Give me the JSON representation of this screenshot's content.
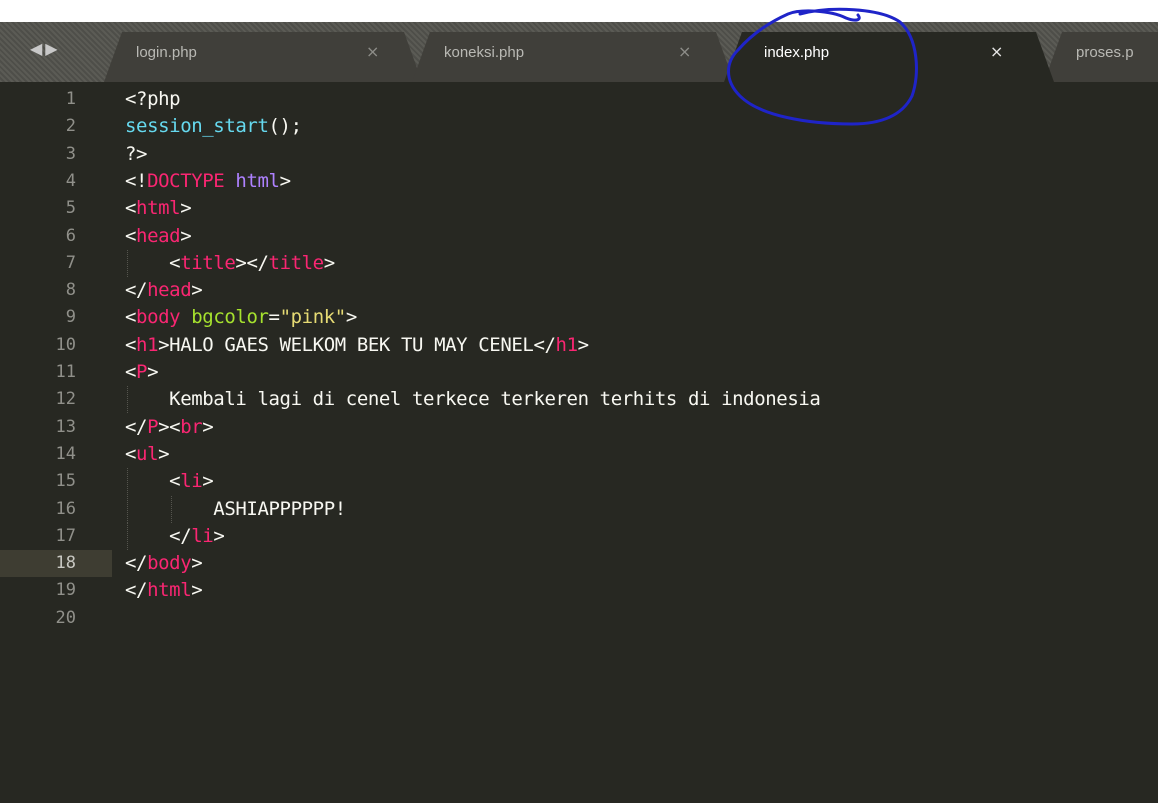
{
  "nav": {
    "arrows": "◀▶"
  },
  "tabs": [
    {
      "label": "login.php",
      "close": "×",
      "active": false
    },
    {
      "label": "koneksi.php",
      "close": "×",
      "active": false
    },
    {
      "label": "index.php",
      "close": "×",
      "active": true
    },
    {
      "label": "proses.p",
      "close": "",
      "active": false
    }
  ],
  "editor": {
    "current_line": 18,
    "lines": [
      {
        "n": "1",
        "tokens": [
          [
            "punc",
            "<?php"
          ]
        ]
      },
      {
        "n": "2",
        "tokens": [
          [
            "fn",
            "session_start"
          ],
          [
            "punc",
            "();"
          ]
        ]
      },
      {
        "n": "3",
        "tokens": [
          [
            "punc",
            "?>"
          ]
        ]
      },
      {
        "n": "4",
        "tokens": [
          [
            "punc",
            "<!"
          ],
          [
            "tag",
            "DOCTYPE"
          ],
          [
            "punc",
            " "
          ],
          [
            "kw",
            "html"
          ],
          [
            "punc",
            ">"
          ]
        ]
      },
      {
        "n": "5",
        "tokens": [
          [
            "punc",
            "<"
          ],
          [
            "tag",
            "html"
          ],
          [
            "punc",
            ">"
          ]
        ]
      },
      {
        "n": "6",
        "tokens": [
          [
            "punc",
            "<"
          ],
          [
            "tag",
            "head"
          ],
          [
            "punc",
            ">"
          ]
        ]
      },
      {
        "n": "7",
        "tokens": [
          [
            "punc",
            "    <"
          ],
          [
            "tag",
            "title"
          ],
          [
            "punc",
            "></"
          ],
          [
            "tag",
            "title"
          ],
          [
            "punc",
            ">"
          ]
        ]
      },
      {
        "n": "8",
        "tokens": [
          [
            "punc",
            "</"
          ],
          [
            "tag",
            "head"
          ],
          [
            "punc",
            ">"
          ]
        ]
      },
      {
        "n": "9",
        "tokens": [
          [
            "punc",
            "<"
          ],
          [
            "tag",
            "body"
          ],
          [
            "punc",
            " "
          ],
          [
            "attr",
            "bgcolor"
          ],
          [
            "punc",
            "="
          ],
          [
            "str",
            "\"pink\""
          ],
          [
            "punc",
            ">"
          ]
        ]
      },
      {
        "n": "10",
        "tokens": [
          [
            "punc",
            "<"
          ],
          [
            "tag",
            "h1"
          ],
          [
            "punc",
            ">"
          ],
          [
            "text",
            "HALO GAES WELKOM BEK TU MAY CENEL"
          ],
          [
            "punc",
            "</"
          ],
          [
            "tag",
            "h1"
          ],
          [
            "punc",
            ">"
          ]
        ]
      },
      {
        "n": "11",
        "tokens": [
          [
            "punc",
            "<"
          ],
          [
            "tag",
            "P"
          ],
          [
            "punc",
            ">"
          ]
        ]
      },
      {
        "n": "12",
        "tokens": [
          [
            "text",
            "    Kembali lagi di cenel terkece terkeren terhits di indonesia"
          ]
        ]
      },
      {
        "n": "13",
        "tokens": [
          [
            "punc",
            "</"
          ],
          [
            "tag",
            "P"
          ],
          [
            "punc",
            "><"
          ],
          [
            "tag",
            "br"
          ],
          [
            "punc",
            ">"
          ]
        ]
      },
      {
        "n": "14",
        "tokens": [
          [
            "punc",
            "<"
          ],
          [
            "tag",
            "ul"
          ],
          [
            "punc",
            ">"
          ]
        ]
      },
      {
        "n": "15",
        "tokens": [
          [
            "punc",
            "    <"
          ],
          [
            "tag",
            "li"
          ],
          [
            "punc",
            ">"
          ]
        ]
      },
      {
        "n": "16",
        "tokens": [
          [
            "text",
            "        ASHIAPPPPPP!"
          ]
        ]
      },
      {
        "n": "17",
        "tokens": [
          [
            "punc",
            "    </"
          ],
          [
            "tag",
            "li"
          ],
          [
            "punc",
            ">"
          ]
        ]
      },
      {
        "n": "18",
        "tokens": [
          [
            "punc",
            "</"
          ],
          [
            "tag",
            "body"
          ],
          [
            "punc",
            ">"
          ]
        ]
      },
      {
        "n": "19",
        "tokens": [
          [
            "punc",
            "</"
          ],
          [
            "tag",
            "html"
          ],
          [
            "punc",
            ">"
          ]
        ]
      },
      {
        "n": "20",
        "tokens": []
      }
    ]
  },
  "annotation": {
    "color": "#1f24c8",
    "shape": "hand-drawn-circle"
  },
  "colors": {
    "background": "#272822",
    "tag": "#f92672",
    "attribute": "#a6e22e",
    "string": "#e6db74",
    "keyword": "#ae81ff",
    "function": "#66d9ef",
    "text": "#f8f8f2"
  }
}
